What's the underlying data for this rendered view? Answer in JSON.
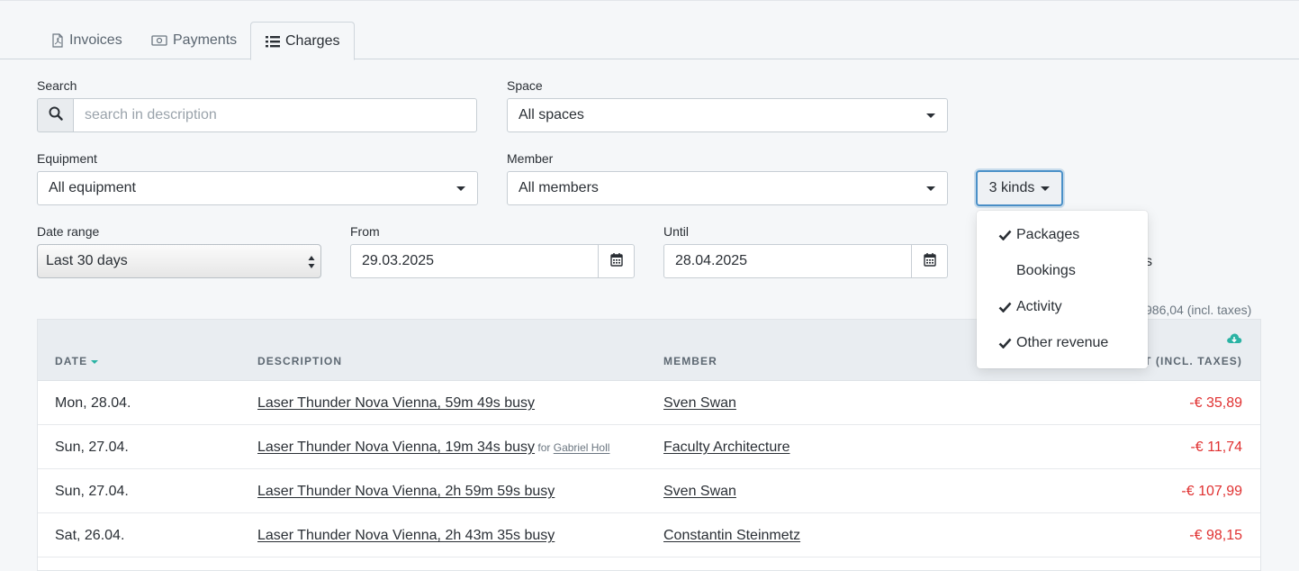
{
  "tabs": [
    {
      "label": "Invoices",
      "icon": "file-pdf-icon"
    },
    {
      "label": "Payments",
      "icon": "money-bill-icon"
    },
    {
      "label": "Charges",
      "icon": "list-icon",
      "active": true
    }
  ],
  "filters": {
    "search": {
      "label": "Search",
      "placeholder": "search in description",
      "value": ""
    },
    "space": {
      "label": "Space",
      "value": "All spaces"
    },
    "equipment": {
      "label": "Equipment",
      "value": "All equipment"
    },
    "member": {
      "label": "Member",
      "value": "All members"
    },
    "kinds": {
      "label": "3 kinds"
    },
    "date_range": {
      "label": "Date range",
      "value": "Last 30 days"
    },
    "from": {
      "label": "From",
      "value": "29.03.2025"
    },
    "until": {
      "label": "Until",
      "value": "28.04.2025"
    }
  },
  "kinds_menu": [
    {
      "label": "Packages",
      "checked": true
    },
    {
      "label": "Bookings",
      "checked": false
    },
    {
      "label": "Activity",
      "checked": true
    },
    {
      "label": "Other revenue",
      "checked": true
    }
  ],
  "partial_text": "s",
  "total_partial": "986,04 (incl. taxes)",
  "table": {
    "headers": {
      "date": "DATE",
      "description": "DESCRIPTION",
      "member": "MEMBER",
      "amount": "T (INCL. TAXES)"
    },
    "rows": [
      {
        "date": "Mon, 28.04.",
        "description": "Laser Thunder Nova Vienna, 59m 49s busy",
        "for_label": "",
        "for_name": "",
        "member": "Sven Swan",
        "amount": "-€ 35,89"
      },
      {
        "date": "Sun, 27.04.",
        "description": "Laser Thunder Nova Vienna, 19m 34s busy",
        "for_label": "for",
        "for_name": "Gabriel Holl",
        "member": "Faculty Architecture",
        "amount": "-€ 11,74"
      },
      {
        "date": "Sun, 27.04.",
        "description": "Laser Thunder Nova Vienna, 2h 59m 59s busy",
        "for_label": "",
        "for_name": "",
        "member": "Sven Swan",
        "amount": "-€ 107,99"
      },
      {
        "date": "Sat, 26.04.",
        "description": "Laser Thunder Nova Vienna, 2h 43m 35s busy",
        "for_label": "",
        "for_name": "",
        "member": "Constantin Steinmetz",
        "amount": "-€ 98,15"
      }
    ]
  },
  "colors": {
    "accent": "#2bb3a4",
    "negative": "#e03131",
    "focus": "#4a90c8"
  }
}
